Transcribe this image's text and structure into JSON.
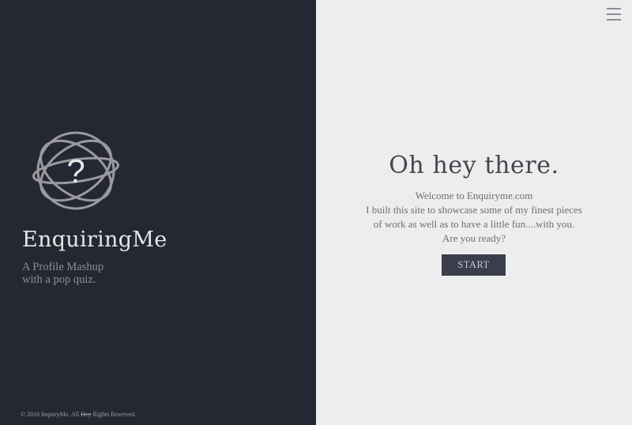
{
  "brand": {
    "logo_icon": "orbit-question-icon",
    "logo_symbol": "?",
    "name": "EnquiringMe",
    "tagline_line1": "A Profile Mashup",
    "tagline_line2": "with a pop quiz."
  },
  "footer": {
    "copyright_prefix": "© 2016 InquiryMe. All",
    "copyright_struck": "Hey",
    "copyright_suffix": "Rights Reserved."
  },
  "menu": {
    "icon": "hamburger-menu-icon"
  },
  "welcome": {
    "headline": "Oh hey there.",
    "lines": [
      "Welcome to Enquiryme.com",
      "I built this site to showcase some of my finest pieces",
      "of work as well as to have a little fun....with you.",
      "Are you ready?"
    ],
    "start_label": "START"
  },
  "colors": {
    "left_panel": "#252833",
    "right_panel": "#ededed",
    "button_bg": "#3a3d4a"
  }
}
